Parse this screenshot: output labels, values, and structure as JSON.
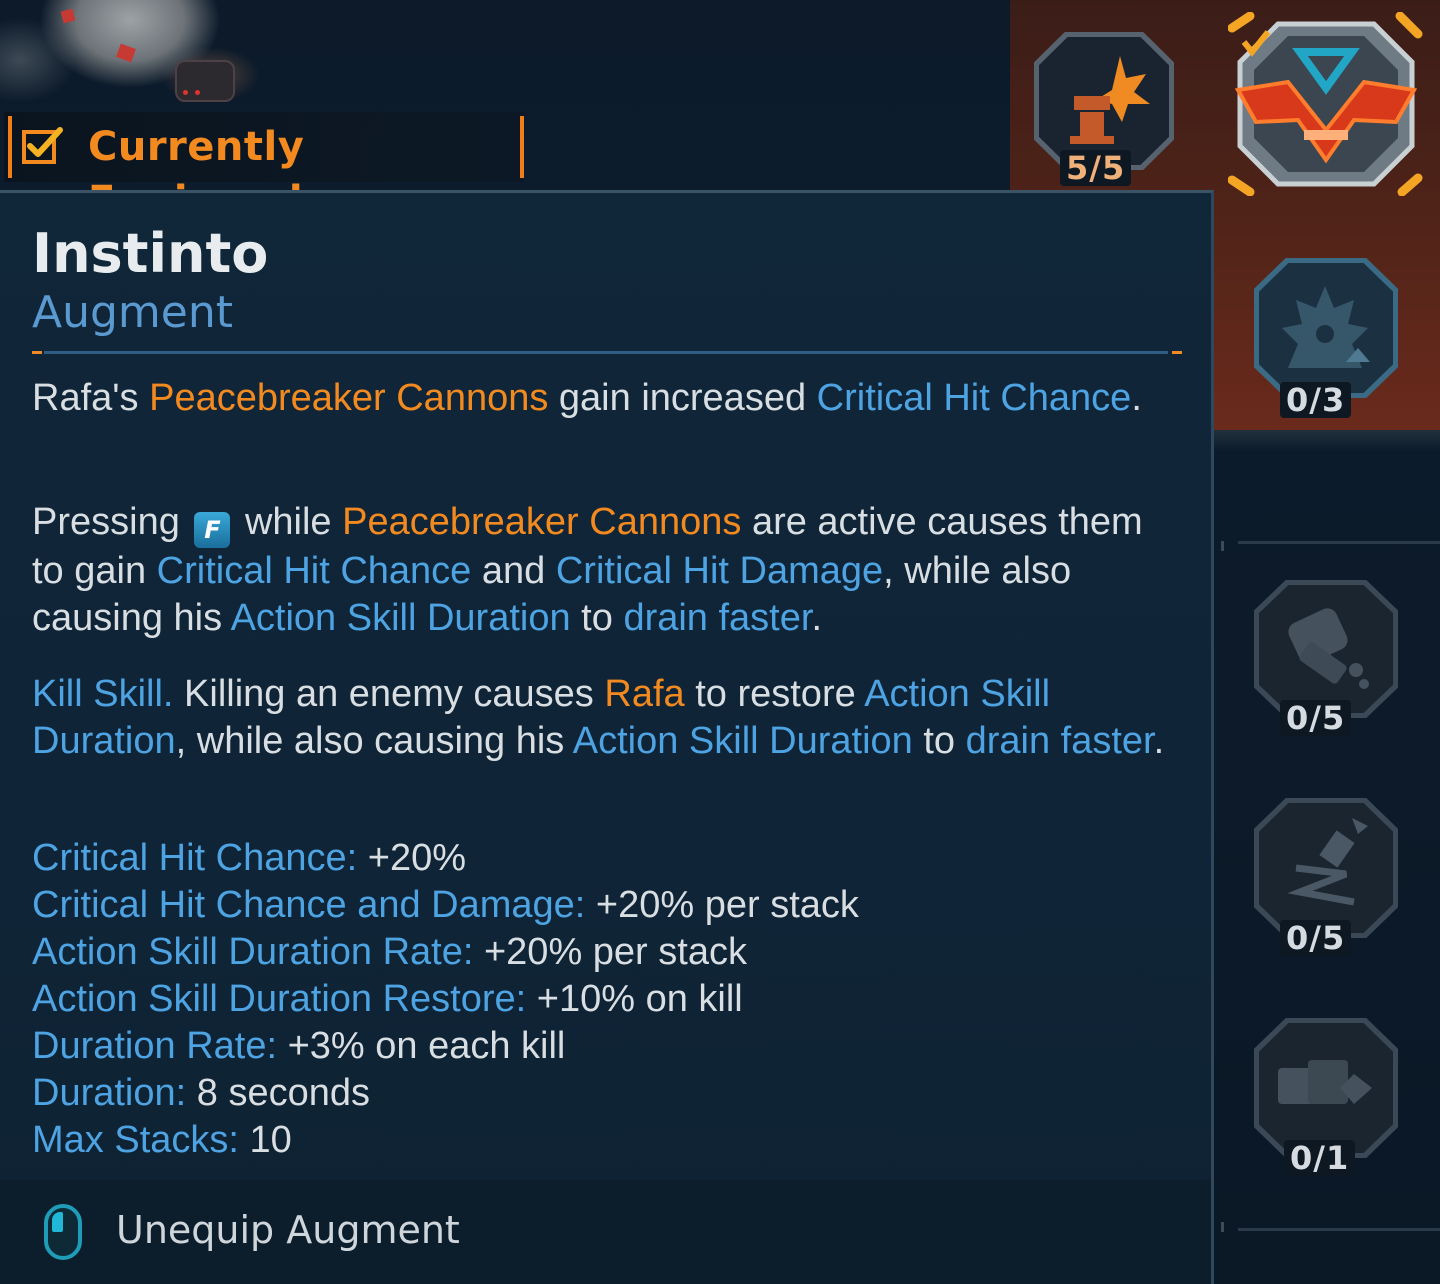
{
  "equipped": {
    "label": "Currently Equipped"
  },
  "tooltip": {
    "title": "Instinto",
    "subtitle": "Augment",
    "paragraphs": {
      "p1": {
        "s1": "Rafa's ",
        "s2": "Peacebreaker Cannons",
        "s3": " gain increased ",
        "s4": "Critical Hit Chance",
        "s5": "."
      },
      "p2": {
        "s1": "Pressing ",
        "key": "F",
        "s2": " while ",
        "s3": "Peacebreaker Cannons",
        "s4": " are active causes them to gain ",
        "s5": "Critical Hit Chance",
        "s6": " and ",
        "s7": "Critical Hit Damage",
        "s8": ", while also causing his ",
        "s9": "Action Skill Duration",
        "s10": " to ",
        "s11": "drain faster",
        "s12": "."
      },
      "p3": {
        "s1": "Kill Skill.",
        "s2": " Killing an enemy causes ",
        "s3": "Rafa",
        "s4": " to restore ",
        "s5": "Action Skill Duration",
        "s6": ", while also causing his ",
        "s7": "Action Skill Duration",
        "s8": " to ",
        "s9": "drain faster",
        "s10": "."
      }
    },
    "stats": [
      {
        "label": "Critical Hit Chance:",
        "value": " +20%"
      },
      {
        "label": "Critical Hit Chance and Damage:",
        "value": " +20% per stack"
      },
      {
        "label": "Action Skill Duration Rate:",
        "value": " +20% per stack"
      },
      {
        "label": "Action Skill Duration Restore:",
        "value": " +10% on kill"
      },
      {
        "label": "Duration Rate:",
        "value": " +3% on each kill"
      },
      {
        "label": "Duration:",
        "value": " 8 seconds"
      },
      {
        "label": "Max Stacks:",
        "value": " 10"
      }
    ],
    "footer": {
      "action_label": "Unequip Augment",
      "icon": "mouse-left-click-icon"
    }
  },
  "skill_nodes": [
    {
      "count": "5/5",
      "icon": "cannon-blast-icon"
    },
    {
      "count": "0/3",
      "icon": "flame-figure-icon"
    },
    {
      "count": "0/5",
      "icon": "gadget-icon"
    },
    {
      "count": "0/5",
      "icon": "zigzag-dash-icon"
    },
    {
      "count": "0/1",
      "icon": "device-icon"
    }
  ],
  "selected_node": {
    "icon": "instinto-emblem-icon"
  },
  "colors": {
    "orange": "#f28a20",
    "blue_keyword": "#4ea3e3",
    "subtitle_blue": "#5a9ad0",
    "panel_bg": "#102739"
  }
}
